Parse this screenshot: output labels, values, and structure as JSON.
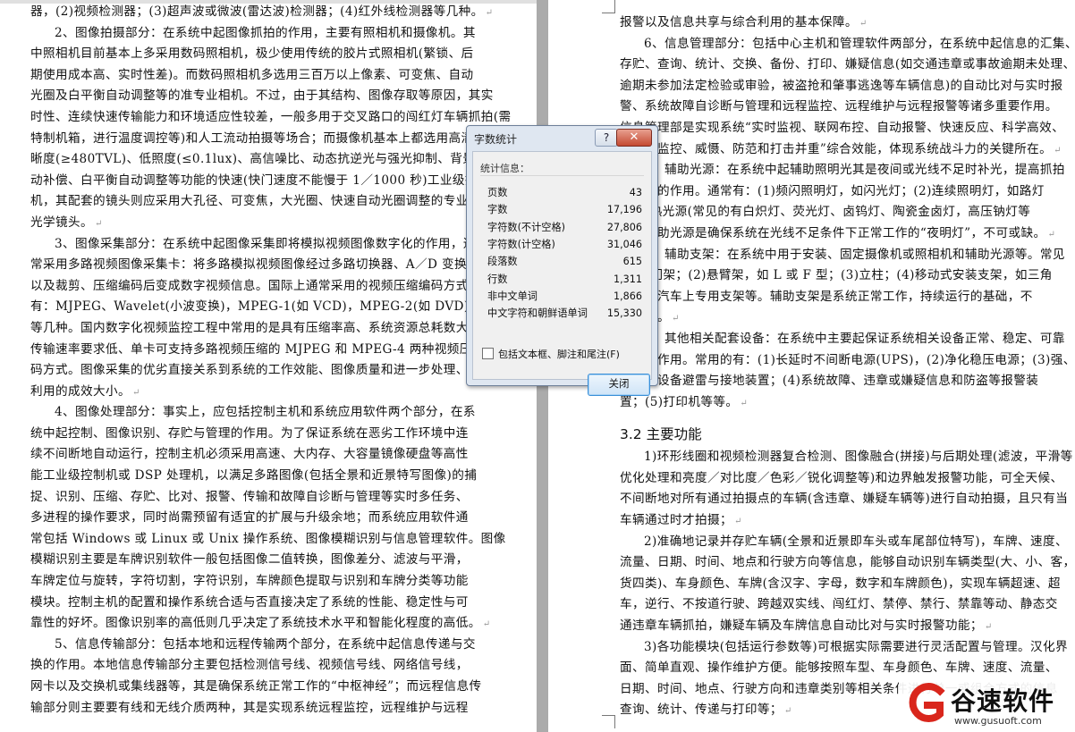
{
  "left_page": {
    "lines": [
      "器，(2)视频检测器；(3)超声波或微波(雷达波)检测器；(4)红外线检测器等几种。",
      "2、图像拍摄部分：在系统中起图像抓拍的作用，主要有照相机和摄像机。其",
      "中照相机目前基本上多采用数码照相机，极少使用传统的胶片式照相机(繁锁、后",
      "期使用成本高、实时性差)。而数码照相机多选用三百万以上像素、可变焦、自动",
      "光圈及白平衡自动调整等的准专业相机。不过，由于其结构、图像存取等原因，其实",
      "时性、连续快速传输能力和环境适应性较差，一般多用于交叉路口的闯红灯车辆抓拍(需",
      "特制机箱，进行温度调控等)和人工流动拍摄等场合；而摄像机基本上都选用高清",
      "晰度(≥480TVL)、低照度(≤0.1lux)、高信噪比、动态抗逆光与强光抑制、背景光自",
      "动补偿、白平衡自动调整等功能的快速(快门速度不能慢于 1／1000 秒)工业级摄像",
      "机，其配套的镜头则应采用大孔径、可变焦，大光圈、快速自动光圈调整的专业",
      "光学镜头。",
      "3、图像采集部分：在系统中起图像采集即将模拟视频图像数字化的作用，通",
      "常采用多路视频图像采集卡：将多路模拟视频图像经过多路切换器、A／D 变换器",
      "以及裁剪、压缩编码后变成数字视频信息。国际上通常采用的视频压缩编码方式",
      "有：MJPEG、Wavelet(小波变换)，MPEG-1(如 VCD)，MPEG-2(如 DVD)和 MPEG-4",
      "等几种。国内数字化视频监控工程中常用的是具有压缩率高、系统资源总耗数大、",
      "传输速率要求低、单卡可支持多路视频压缩的 MJPEG 和 MPEG-4 两种视频压缩编",
      "码方式。图像采集的优劣直接关系到系统的工作效能、图像质量和进一步处理、",
      "利用的成效大小。",
      "4、图像处理部分：事实上，应包括控制主机和系统应用软件两个部分，在系",
      "统中起控制、图像识别、存贮与管理的作用。为了保证系统在恶劣工作环境中连",
      "续不间断地自动运行，控制主机必须采用高速、大内存、大容量镜像硬盘等高性",
      "能工业级控制机或 DSP 处理机，以满足多路图像(包括全景和近景特写图像)的捕",
      "捉、识别、压缩、存贮、比对、报警、传输和故障自诊断与管理等实时多任务、",
      "多进程的操作要求，同时尚需预留有适宜的扩展与升级余地；而系统应用软件通",
      "常包括 Windows 或 Linux 或 Unix 操作系统、图像模糊识别与信息管理软件。图像",
      "模糊识别主要是车牌识别软件一般包括图像二值转换，图像差分、滤波与平滑，",
      "车牌定位与旋转，字符切割，字符识别，车牌颜色提取与识别和车牌分类等功能",
      "模块。控制主机的配置和操作系统合适与否直接决定了系统的性能、稳定性与可",
      "靠性的好坏。图像识别率的高低则几乎决定了系统技术水平和智能化程度的高低。",
      "5、信息传输部分：包括本地和远程传输两个部分，在系统中起信息传递与交",
      "换的作用。本地信息传输部分主要包括检测信号线、视频信号线、网络信号线，",
      "网卡以及交换机或集线器等，其是确保系统正常工作的“中枢神经”；而远程信息传",
      "输部分则主要要有线和无线介质两种，其是实现系统远程监控，远程维护与远程"
    ],
    "indent_lines": [
      1,
      11,
      19,
      30
    ],
    "para_end_lines": [
      0,
      10,
      18,
      29
    ]
  },
  "right_page": {
    "lines": [
      "报警以及信息共享与综合利用的基本保障。",
      "6、信息管理部分：包括中心主机和管理软件两部分，在系统中起信息的汇集、",
      "存贮、查询、统计、交换、备份、打印、嫌疑信息(如交通违章或事故逾期未处理、",
      "逾期未参加法定检验或审验，被盗抢和肇事逃逸等车辆信息)的自动比对与实时报",
      "警、系统故障自诊断与管理和远程监控、远程维护与远程报警等诸多重要作用。",
      "信息管理部是实现系统“实时监视、联网布控、自动报警、快速反应、科学高效、",
      "管理、监控、威慑、防范和打击并重”综合效能，体现系统战斗力的关键所在。",
      "7、辅助光源：在系统中起辅助照明光其是夜间或光线不足时补光，提高抓拍",
      "清晰度的作用。通常有：(1)频闪照明灯，如闪光灯；(2)连续照明灯，如路灯",
      "(冷、热光源(常见的有白炽灯、荧光灯、卤钨灯、陶瓷金卤灯，高压钠灯等",
      "等。辅助光源是确保系统在光线不足条件下正常工作的“夜明灯”，不可或缺。",
      "8、辅助支架：在系统中用于安装、固定摄像机或照相机和辅助光源等。常见",
      "(1)龙门架；(2)悬臂架，如 L 或 F 型；(3)立柱；(4)移动式安装支架，如三角",
      "架或在汽车上专用支架等。辅助支架是系统正常工作，持续运行的基础，不",
      "可或缺。",
      "9、其他相关配套设备：在系统中主要起保证系统相关设备正常、稳定、可靠",
      "运行的作用。常用的有：(1)长延时不间断电源(UPS)，(2)净化稳压电源；(3)强、",
      "弱电、设备避雷与接地装置；(4)系统故障、违章或嫌疑信息和防盗等报警装",
      "置；(5)打印机等等。"
    ],
    "indent_lines": [
      1,
      7,
      11,
      15
    ],
    "para_end_lines": [
      0,
      6,
      10,
      14,
      18
    ],
    "heading": "3.2 主要功能",
    "lines2": [
      "1)环形线圈和视频检测器复合检测、图像融合(拼接)与后期处理(滤波，平滑等",
      "优化处理和亮度／对比度／色彩／锐化调整等)和边界触发报警功能，可全天候、",
      "不间断地对所有通过拍摄点的车辆(含违章、嫌疑车辆等)进行自动拍摄，且只有当",
      "车辆通过时才拍摄；",
      "2)准确地记录并存贮车辆(全景和近景即车头或车尾部位特写)，车牌、速度、",
      "流量、日期、时间、地点和行驶方向等信息，能够自动识别车辆类型(大、小、客，",
      "货四类)、车身颜色、车牌(含汉字、字母，数字和车牌颜色)，实现车辆超速、超",
      "车，逆行、不按道行驶、跨越双实线、闯红灯、禁停、禁行、禁靠等动、静态交",
      "通违章车辆抓拍，嫌疑车辆及车牌信息自动比对与实时报警功能；",
      "3)各功能模块(包括运行参数等)可根据实际需要进行灵活配置与管理。汉化界",
      "面、简单直观、操作维护方便。能够按照车型、车身颜色、车牌、速度、流量、",
      "日期、时间、地点、行驶方向和违章类别等相关条件进行单一或组合方式的信息",
      "查询、统计、传递与打印等；"
    ],
    "indent_lines2": [
      0,
      4,
      9
    ],
    "para_end_lines2": [
      3,
      8,
      12
    ]
  },
  "dialog": {
    "title": "字数统计",
    "help_label": "?",
    "close_label": "✕",
    "stats_label": "统计信息：",
    "stats": [
      {
        "label": "页数",
        "value": "43"
      },
      {
        "label": "字数",
        "value": "17,196"
      },
      {
        "label": "字符数(不计空格)",
        "value": "27,806"
      },
      {
        "label": "字符数(计空格)",
        "value": "31,046"
      },
      {
        "label": "段落数",
        "value": "615"
      },
      {
        "label": "行数",
        "value": "1,311"
      },
      {
        "label": "非中文单词",
        "value": "1,866"
      },
      {
        "label": "中文字符和朝鲜语单词",
        "value": "15,330"
      }
    ],
    "include_label": "包括文本框、脚注和尾注(F)",
    "include_checked": false,
    "ok_label": "关闭"
  },
  "logo": {
    "name": "谷速软件",
    "url": "www.gusuoft.com",
    "color": "#d9261c"
  },
  "paragraph_mark": "↵"
}
